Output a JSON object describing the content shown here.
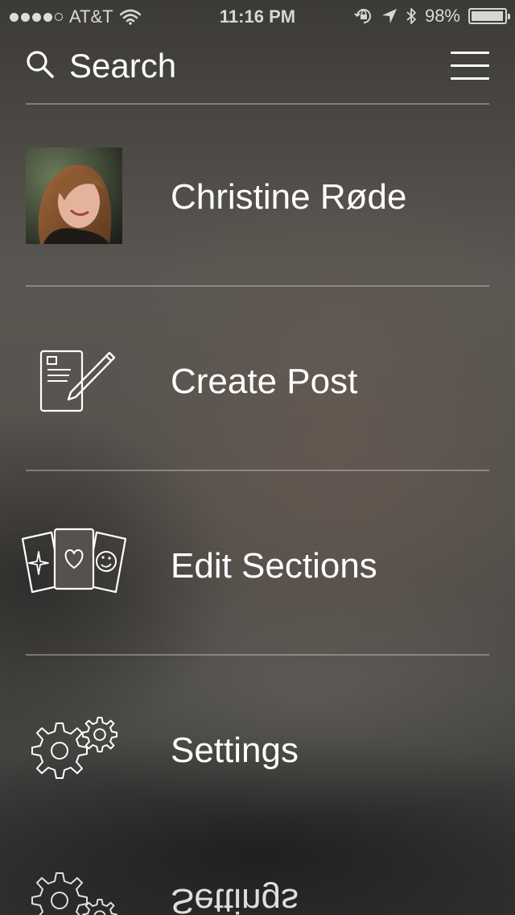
{
  "status_bar": {
    "carrier": "AT&T",
    "time": "11:16 PM",
    "battery_percent_text": "98%",
    "battery_level": 0.98,
    "signal_bars_filled": 4,
    "signal_bars_total": 5
  },
  "header": {
    "search_label": "Search",
    "menu_icon": "hamburger-menu-icon"
  },
  "menu": {
    "items": [
      {
        "label": "Christine Røde",
        "icon": "user-avatar"
      },
      {
        "label": "Create Post",
        "icon": "create-post-icon"
      },
      {
        "label": "Edit Sections",
        "icon": "edit-sections-icon"
      },
      {
        "label": "Settings",
        "icon": "settings-gears-icon"
      }
    ]
  },
  "colors": {
    "text": "#ffffff",
    "divider": "#c8c4be",
    "background": "#4f4c48"
  }
}
